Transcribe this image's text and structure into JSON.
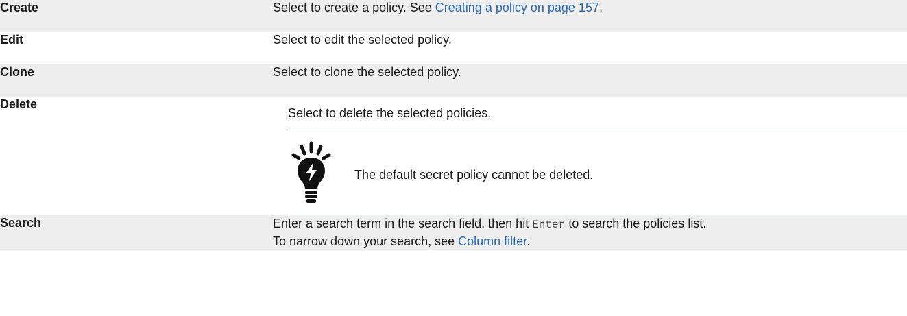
{
  "rows": [
    {
      "term": "Create",
      "desc_prefix": "Select to create a policy. See ",
      "desc_link": "Creating a policy on page 157",
      "desc_suffix": "."
    },
    {
      "term": "Edit",
      "desc": "Select to edit the selected policy."
    },
    {
      "term": "Clone",
      "desc": "Select to clone the selected policy."
    },
    {
      "term": "Delete",
      "desc": "Select to delete the selected policies.",
      "note": {
        "icon": "lightbulb-tip-icon",
        "text": "The default secret policy cannot be deleted."
      }
    },
    {
      "term": "Search",
      "desc_line1_prefix": "Enter a search term in the search field, then hit ",
      "desc_line1_code": "Enter",
      "desc_line1_suffix": " to search the policies list.",
      "desc_line2_prefix": "To narrow down your search, see ",
      "desc_line2_link": "Column filter",
      "desc_line2_suffix": "."
    }
  ],
  "colors": {
    "shaded_row": "#eeeeee",
    "link": "#2a6ab0",
    "rule": "#2d3b4a"
  }
}
